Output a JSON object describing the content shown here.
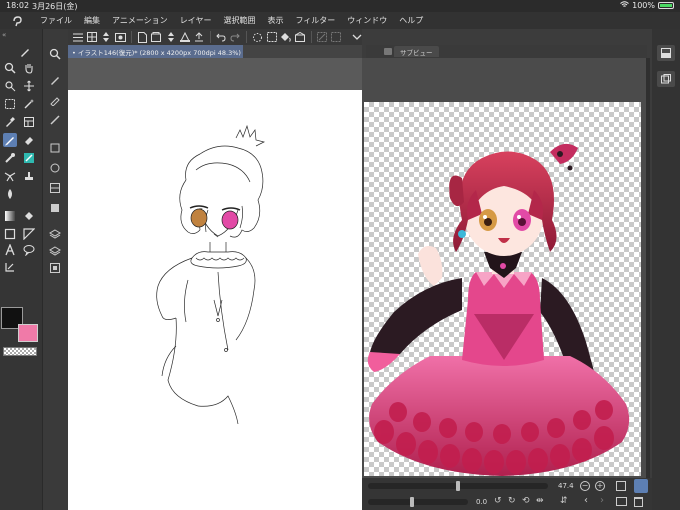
{
  "status_bar": {
    "time": "18:02",
    "date": "3月26日(金)",
    "battery": "100%",
    "battery_color": "#4cd964"
  },
  "menu": {
    "items": [
      "ファイル",
      "編集",
      "アニメーション",
      "レイヤー",
      "選択範囲",
      "表示",
      "フィルター",
      "ウィンドウ",
      "ヘルプ"
    ]
  },
  "document": {
    "tab_label": "• イラスト146(復元)* (2800 x 4200px 700dpi 48.3%)"
  },
  "subview": {
    "tab_label": "サブビュー"
  },
  "navigator": {
    "zoom": "47.4",
    "angle": "0.0"
  },
  "colors": {
    "main_color": "#111111",
    "sub_color": "#f07aa8",
    "accent": "#5d7fb3"
  },
  "icons": {
    "left_tools": [
      "pen-icon",
      "hand-icon",
      "zoom-icon",
      "move-icon",
      "lasso-icon",
      "select-rect-icon",
      "wand-icon",
      "eyedropper-icon",
      "layer-move-icon",
      "brush-icon",
      "eraser-icon",
      "blend-icon",
      "airbrush-icon",
      "fill-icon",
      "gradient-icon",
      "figure-icon",
      "text-icon",
      "balloon-icon",
      "frame-icon",
      "ruler-icon",
      "operation-icon",
      "correction-icon"
    ]
  }
}
